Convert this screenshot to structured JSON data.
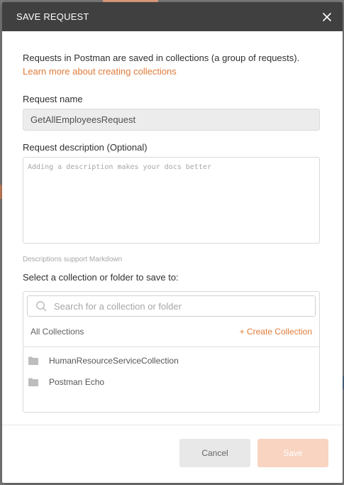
{
  "dialog": {
    "title": "SAVE REQUEST",
    "intro_text": "Requests in Postman are saved in collections (a group of requests).",
    "learn_link": "Learn more about creating collections"
  },
  "request_name": {
    "label": "Request name",
    "value": "GetAllEmployeesRequest"
  },
  "request_description": {
    "label": "Request description (Optional)",
    "placeholder": "Adding a description makes your docs better",
    "hint": "Descriptions support Markdown"
  },
  "collection_picker": {
    "label": "Select a collection or folder to save to:",
    "search_placeholder": "Search for a collection or folder",
    "all_collections": "All Collections",
    "create_collection": "+ Create Collection",
    "items": [
      {
        "name": "HumanResourceServiceCollection",
        "icon": "folder-icon"
      },
      {
        "name": "Postman Echo",
        "icon": "folder-icon"
      }
    ]
  },
  "footer": {
    "cancel_label": "Cancel",
    "save_label": "Save"
  },
  "colors": {
    "header_bg": "#404040",
    "accent": "#e07b39",
    "save_disabled": "#f8d4c1"
  }
}
